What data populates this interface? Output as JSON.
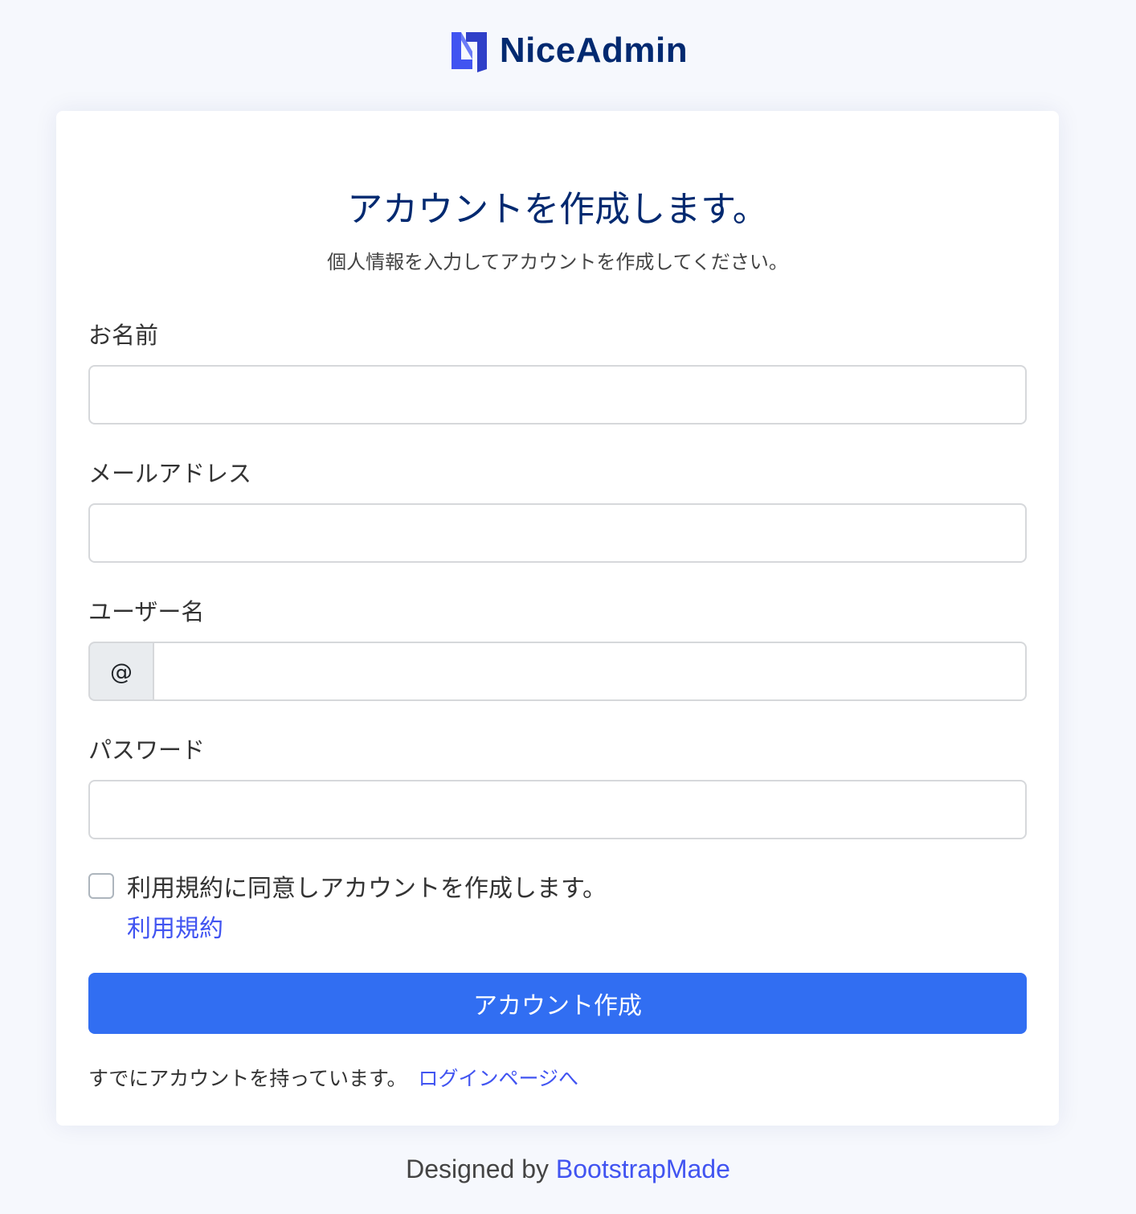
{
  "brand": {
    "name": "NiceAdmin",
    "logo_icon": "nice-admin-logo-icon",
    "accent": "#4154f1",
    "text_color": "#012970"
  },
  "card": {
    "title": "アカウントを作成します。",
    "subtitle": "個人情報を入力してアカウントを作成してください。"
  },
  "form": {
    "name_label": "お名前",
    "name_value": "",
    "email_label": "メールアドレス",
    "email_value": "",
    "username_label": "ユーザー名",
    "username_prefix": "@",
    "username_value": "",
    "password_label": "パスワード",
    "password_value": "",
    "terms_checked": false,
    "terms_text": "利用規約に同意しアカウントを作成します。",
    "terms_link": "利用規約",
    "submit_label": "アカウント作成",
    "submit_color": "#316ef2"
  },
  "login": {
    "text": "すでにアカウントを持っています。",
    "link": "ログインページへ"
  },
  "footer": {
    "prefix": "Designed by",
    "link": "BootstrapMade"
  }
}
